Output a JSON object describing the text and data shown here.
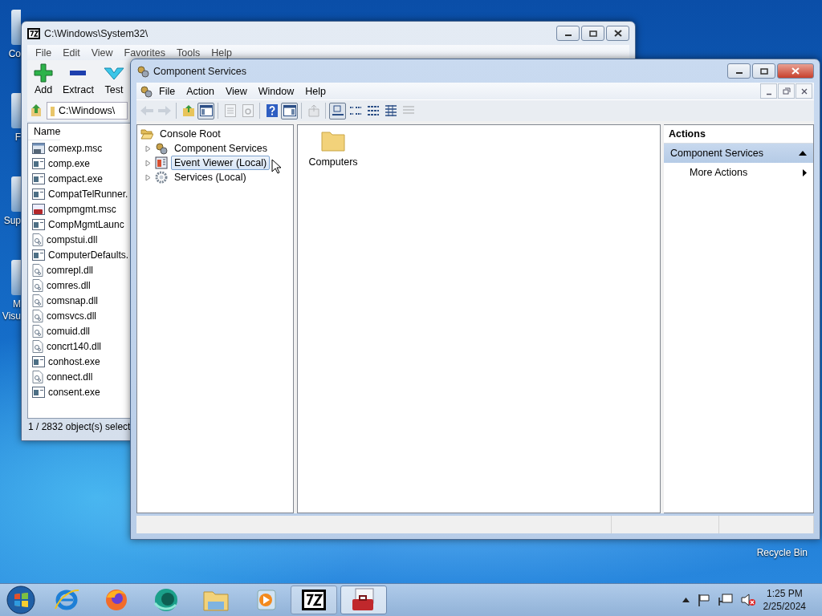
{
  "desktop": {
    "icons": [
      {
        "lines": [
          "Co"
        ]
      },
      {
        "lines": [
          "F"
        ]
      },
      {
        "lines": [
          "Sup"
        ]
      },
      {
        "lines": [
          "M",
          "Visu"
        ]
      }
    ],
    "recycle_bin": {
      "label": "Recycle Bin"
    }
  },
  "archiver": {
    "title": "C:\\Windows\\System32\\",
    "menu": [
      "File",
      "Edit",
      "View",
      "Favorites",
      "Tools",
      "Help"
    ],
    "toolbar": [
      {
        "kind": "add",
        "label": "Add"
      },
      {
        "kind": "extract",
        "label": "Extract"
      },
      {
        "kind": "test",
        "label": "Test"
      }
    ],
    "address": "C:\\Windows\\",
    "columns": [
      "Name"
    ],
    "files": [
      {
        "name": "comexp.msc",
        "kind": "msc"
      },
      {
        "name": "comp.exe",
        "kind": "exe"
      },
      {
        "name": "compact.exe",
        "kind": "exe"
      },
      {
        "name": "CompatTelRunner.",
        "kind": "exe"
      },
      {
        "name": "compmgmt.msc",
        "kind": "toolbox"
      },
      {
        "name": "CompMgmtLaunc",
        "kind": "exe"
      },
      {
        "name": "compstui.dll",
        "kind": "dll"
      },
      {
        "name": "ComputerDefaults.",
        "kind": "exe"
      },
      {
        "name": "comrepl.dll",
        "kind": "dll"
      },
      {
        "name": "comres.dll",
        "kind": "dll"
      },
      {
        "name": "comsnap.dll",
        "kind": "dll"
      },
      {
        "name": "comsvcs.dll",
        "kind": "dll"
      },
      {
        "name": "comuid.dll",
        "kind": "dll"
      },
      {
        "name": "concrt140.dll",
        "kind": "dll"
      },
      {
        "name": "conhost.exe",
        "kind": "exe"
      },
      {
        "name": "connect.dll",
        "kind": "dll"
      },
      {
        "name": "consent.exe",
        "kind": "exe"
      }
    ],
    "status": "1 / 2832 object(s) select"
  },
  "console": {
    "title": "Component Services",
    "menu": [
      "File",
      "Action",
      "View",
      "Window",
      "Help"
    ],
    "toolbar": [
      {
        "kind": "back",
        "disabled": true,
        "pressed": false
      },
      {
        "kind": "forward",
        "disabled": true,
        "pressed": false
      },
      {
        "kind": "separator"
      },
      {
        "kind": "up",
        "disabled": false,
        "pressed": false
      },
      {
        "kind": "tree",
        "disabled": false,
        "pressed": true
      },
      {
        "kind": "separator"
      },
      {
        "kind": "properties",
        "disabled": true,
        "pressed": false
      },
      {
        "kind": "refresh",
        "disabled": true,
        "pressed": false
      },
      {
        "kind": "separator"
      },
      {
        "kind": "help",
        "disabled": false,
        "pressed": false
      },
      {
        "kind": "actionpane",
        "disabled": false,
        "pressed": true
      },
      {
        "kind": "separator"
      },
      {
        "kind": "export",
        "disabled": true,
        "pressed": false
      },
      {
        "kind": "separator"
      },
      {
        "kind": "largeicons",
        "disabled": false,
        "pressed": true
      },
      {
        "kind": "smallicons",
        "disabled": false,
        "pressed": false
      },
      {
        "kind": "list",
        "disabled": false,
        "pressed": false
      },
      {
        "kind": "details",
        "disabled": false,
        "pressed": false
      },
      {
        "kind": "other",
        "disabled": true,
        "pressed": false
      }
    ],
    "tree": [
      {
        "label": "Console Root",
        "kind": "folder",
        "expanded": true,
        "selected": false,
        "children": [
          {
            "label": "Component Services",
            "kind": "components",
            "expanded": false,
            "selected": false
          },
          {
            "label": "Event Viewer (Local)",
            "kind": "eventlog",
            "expanded": false,
            "selected": true
          },
          {
            "label": "Services (Local)",
            "kind": "gear",
            "expanded": false,
            "selected": false
          }
        ]
      }
    ],
    "items": [
      {
        "label": "Computers",
        "kind": "folder"
      }
    ],
    "actions": {
      "title": "Actions",
      "sections": [
        {
          "label": "Component Services",
          "expanded": true,
          "items": [
            {
              "label": "More Actions",
              "submenu": true
            }
          ]
        }
      ]
    }
  },
  "taskbar": {
    "items": [
      {
        "kind": "ie",
        "running": false,
        "selected": false
      },
      {
        "kind": "firefox",
        "running": false,
        "selected": false
      },
      {
        "kind": "orb",
        "running": false,
        "selected": false
      },
      {
        "kind": "explorer",
        "running": false,
        "selected": false
      },
      {
        "kind": "media",
        "running": false,
        "selected": false
      },
      {
        "kind": "sevenzip",
        "running": true,
        "selected": false
      },
      {
        "kind": "toolbox",
        "running": true,
        "selected": true
      }
    ],
    "tray": {
      "icons": [
        {
          "kind": "show-hidden"
        },
        {
          "kind": "flag"
        },
        {
          "kind": "network"
        },
        {
          "kind": "volume-muted"
        }
      ],
      "time": "1:25 PM",
      "date": "2/25/2024"
    }
  }
}
